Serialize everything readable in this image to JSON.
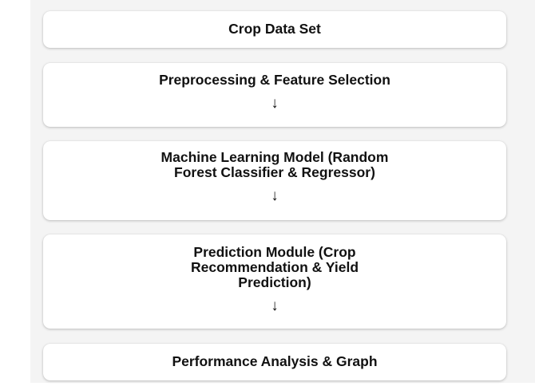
{
  "flowchart": {
    "steps": [
      {
        "label": "Crop Data Set",
        "arrow": ""
      },
      {
        "label": "Preprocessing & Feature Selection",
        "arrow": "↓"
      },
      {
        "label": "Machine Learning Model (Random\nForest Classifier & Regressor)",
        "arrow": "↓"
      },
      {
        "label": "Prediction Module (Crop\nRecommendation & Yield\nPrediction)",
        "arrow": "↓"
      },
      {
        "label": "Performance Analysis & Graph",
        "arrow": ""
      }
    ]
  },
  "colors": {
    "background": "#f4f4f4",
    "box": "#ffffff",
    "text": "#111111"
  }
}
